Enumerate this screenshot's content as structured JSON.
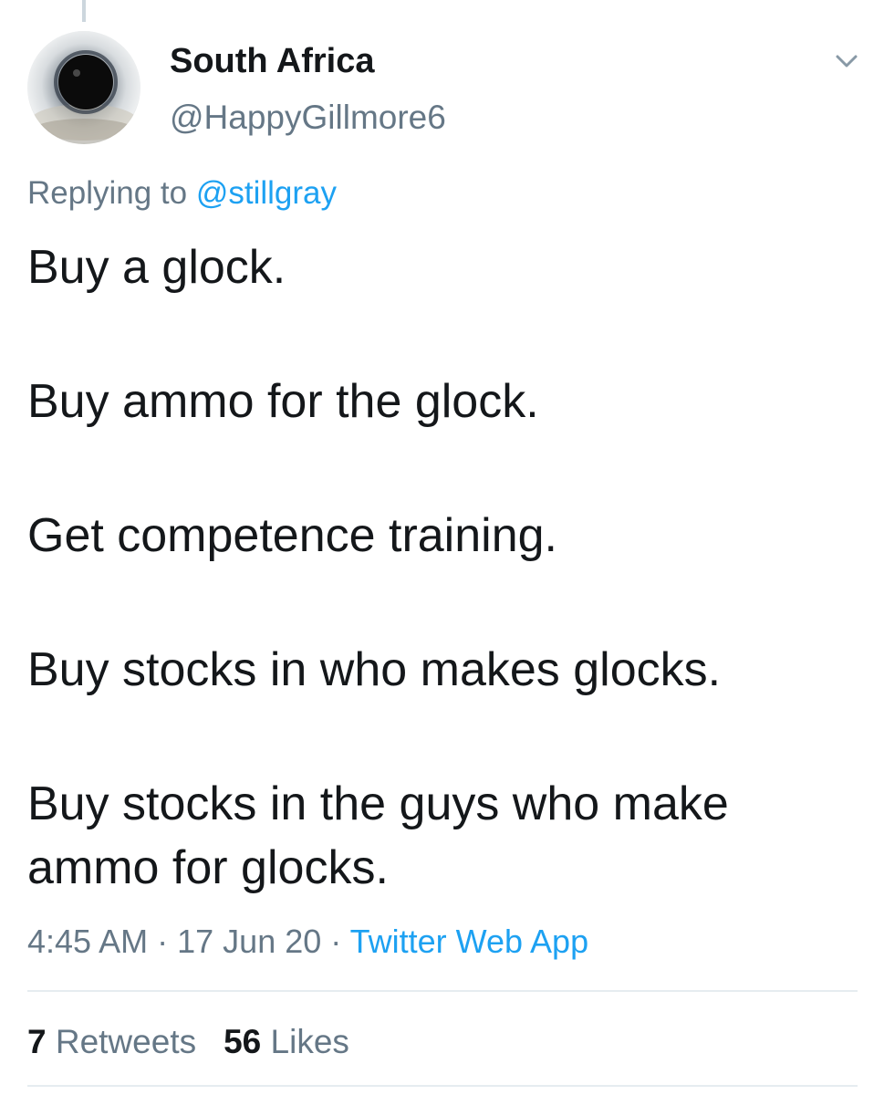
{
  "author": {
    "display_name": "South Africa",
    "handle": "@HappyGillmore6",
    "avatar_icon": "eye-avatar"
  },
  "reply": {
    "prefix": "Replying to",
    "mention": "@stillgray"
  },
  "tweet": {
    "lines": [
      "Buy a glock.",
      "Buy ammo for the glock.",
      "Get competence training.",
      "Buy stocks in who makes glocks.",
      "Buy stocks in the guys who make ammo for glocks."
    ]
  },
  "meta": {
    "time": "4:45 AM",
    "separator": "·",
    "date": "17 Jun 20",
    "source": "Twitter Web App"
  },
  "stats": {
    "retweets_count": "7",
    "retweets_label": "Retweets",
    "likes_count": "56",
    "likes_label": "Likes"
  },
  "colors": {
    "text": "#14171a",
    "secondary": "#657786",
    "link": "#1da1f2",
    "divider": "#e6ecf0"
  }
}
